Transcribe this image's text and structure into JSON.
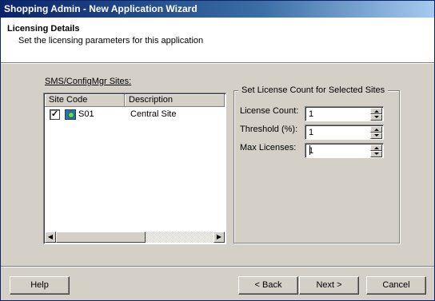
{
  "window": {
    "title": "Shopping Admin - New Application Wizard"
  },
  "header": {
    "title": "Licensing Details",
    "subtitle": "Set the licensing parameters for this application"
  },
  "sites": {
    "label": "SMS/ConfigMgr Sites:",
    "columns": [
      "Site Code",
      "Description"
    ],
    "rows": [
      {
        "checked": true,
        "icon": "site-server-icon",
        "code": "S01",
        "description": "Central Site"
      }
    ]
  },
  "license": {
    "group_title": "Set License Count for Selected Sites",
    "license_count_label": "License Count:",
    "license_count_value": "1",
    "threshold_label": "Threshold (%):",
    "threshold_value": "1",
    "max_licenses_label": "Max Licenses:",
    "max_licenses_value": "1"
  },
  "buttons": {
    "help": "Help",
    "back": "< Back",
    "next": "Next >",
    "cancel": "Cancel"
  }
}
